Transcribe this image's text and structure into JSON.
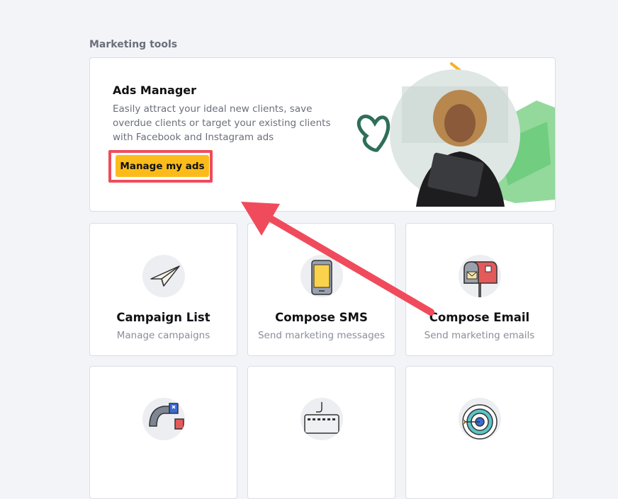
{
  "section": {
    "title": "Marketing tools"
  },
  "ads_manager": {
    "title": "Ads Manager",
    "description": "Easily attract your ideal new clients, save overdue clients or target your existing clients with Facebook and Instagram ads",
    "button_label": "Manage my ads"
  },
  "tiles": [
    {
      "title": "Campaign List",
      "subtitle": "Manage campaigns",
      "icon": "paper-plane-icon"
    },
    {
      "title": "Compose SMS",
      "subtitle": "Send marketing messages",
      "icon": "phone-icon"
    },
    {
      "title": "Compose Email",
      "subtitle": "Send marketing emails",
      "icon": "mailbox-icon"
    },
    {
      "title": "",
      "subtitle": "",
      "icon": "magnet-icon"
    },
    {
      "title": "",
      "subtitle": "",
      "icon": "keyboard-icon"
    },
    {
      "title": "",
      "subtitle": "",
      "icon": "target-icon"
    }
  ],
  "colors": {
    "accent_button": "#fbbc1b",
    "highlight": "#f04b5c",
    "background": "#f3f4f7"
  }
}
